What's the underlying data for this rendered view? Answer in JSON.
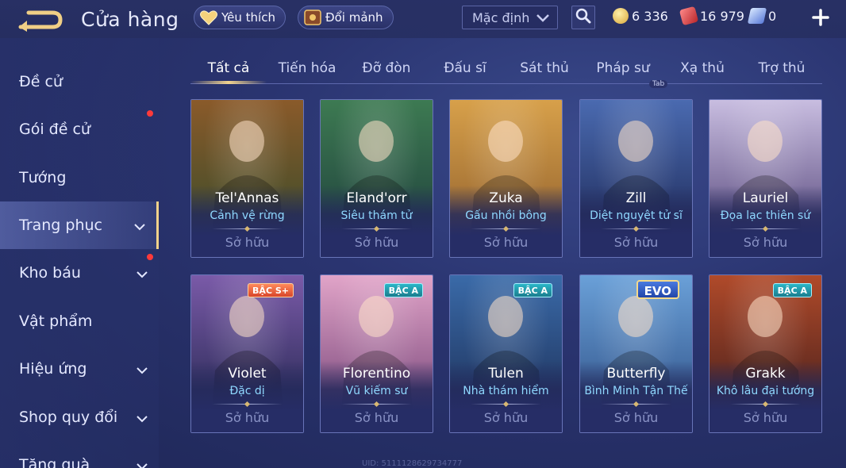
{
  "header": {
    "title": "Cửa hàng",
    "favorite_label": "Yêu thích",
    "exchange_label": "Đổi mảnh",
    "sort_value": "Mặc định",
    "currencies": [
      {
        "name": "gold",
        "value": "6 336",
        "color": "#e9c766"
      },
      {
        "name": "voucher",
        "value": "16 979",
        "color": "#e0565a"
      },
      {
        "name": "diamond",
        "value": "0",
        "color": "#8fb4ff"
      }
    ]
  },
  "sidebar": {
    "items": [
      {
        "label": "Đề cử"
      },
      {
        "label": "Gói đề cử"
      },
      {
        "label": "Tướng"
      },
      {
        "label": "Trang phục"
      },
      {
        "label": "Kho báu"
      },
      {
        "label": "Vật phẩm"
      },
      {
        "label": "Hiệu ứng"
      },
      {
        "label": "Shop quy đổi"
      },
      {
        "label": "Tặng quà"
      }
    ]
  },
  "tabs": {
    "items": [
      "Tất cả",
      "Tiến hóa",
      "Đỡ đòn",
      "Đấu sĩ",
      "Sát thủ",
      "Pháp sư",
      "Xạ thủ",
      "Trợ thủ"
    ],
    "hint": "Tab"
  },
  "cards": [
    {
      "hero": "Tel'Annas",
      "skin": "Cảnh vệ rừng",
      "status": "Sở hữu",
      "badge": "",
      "art": [
        "#8a5a2a",
        "#2f4a2a"
      ]
    },
    {
      "hero": "Eland'orr",
      "skin": "Siêu thám tử",
      "status": "Sở hữu",
      "badge": "",
      "art": [
        "#3d7a52",
        "#1c3a3a"
      ]
    },
    {
      "hero": "Zuka",
      "skin": "Gấu nhồi bông",
      "status": "Sở hữu",
      "badge": "",
      "art": [
        "#d7a04a",
        "#8a5a2a"
      ]
    },
    {
      "hero": "Zill",
      "skin": "Diệt nguyệt tử sĩ",
      "status": "Sở hữu",
      "badge": "",
      "art": [
        "#4a6ab0",
        "#1a2450"
      ]
    },
    {
      "hero": "Lauriel",
      "skin": "Đọa lạc thiên sứ",
      "status": "Sở hữu",
      "badge": "",
      "art": [
        "#c8bde0",
        "#4a3a70"
      ]
    },
    {
      "hero": "Violet",
      "skin": "Đặc dị",
      "status": "Sở hữu",
      "badge": "BẬC S+",
      "art": [
        "#7a5aa8",
        "#1c2248"
      ]
    },
    {
      "hero": "Florentino",
      "skin": "Vũ kiếm sư",
      "status": "Sở hữu",
      "badge": "BẬC A",
      "art": [
        "#e1a4c8",
        "#6a3a70"
      ]
    },
    {
      "hero": "Tulen",
      "skin": "Nhà thám hiểm",
      "status": "Sở hữu",
      "badge": "BẬC A",
      "art": [
        "#3a6aa8",
        "#1a2a50"
      ]
    },
    {
      "hero": "Butterfly",
      "skin": "Bình Minh Tận Thế",
      "status": "Sở hữu",
      "badge": "EVO",
      "art": [
        "#6aa0d8",
        "#2a4a80"
      ]
    },
    {
      "hero": "Grakk",
      "skin": "Khô lâu đại tướng",
      "status": "Sở hữu",
      "badge": "BẬC A",
      "art": [
        "#b04a2a",
        "#3a1a1a"
      ]
    }
  ],
  "footer_uid": "UID: 5111128629734777"
}
